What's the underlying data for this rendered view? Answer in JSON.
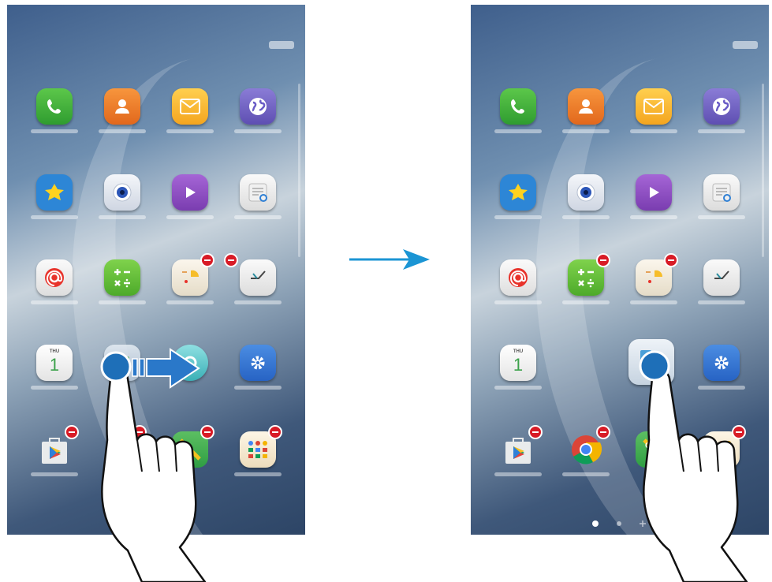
{
  "screens": [
    {
      "id": "before",
      "description_label": ""
    },
    {
      "id": "after",
      "description_label": ""
    }
  ],
  "calendar_icon": {
    "day": "THU",
    "date": "1"
  },
  "icons": {
    "phone": "phone-icon",
    "contacts": "contacts-icon",
    "messages": "email-icon",
    "internet": "globe-icon",
    "gallery": "gallery-icon",
    "camera": "camera-icon",
    "video": "play-icon",
    "memo": "memo-icon",
    "email": "at-sign-icon",
    "calculator": "calculator-icon",
    "calendar_app": "s-planner-icon",
    "clock": "clock-icon",
    "settings": "gear-icon",
    "play_store": "play-store-icon",
    "chrome": "chrome-icon",
    "maps": "maps-icon",
    "google_folder": "google-folder-icon",
    "move_arrow": "right-arrow-icon",
    "touch": "finger-touch-icon"
  },
  "colors": {
    "accent_arrow": "#1b95d4",
    "touch_dot": "#1e6fb8",
    "remove_badge": "#d81b26"
  },
  "page_indicator": {
    "pages": 3,
    "current": 1
  }
}
